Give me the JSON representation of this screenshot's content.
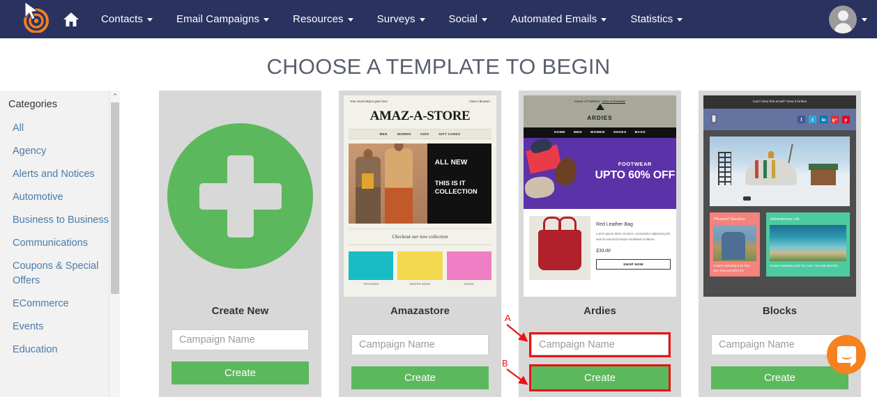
{
  "navbar": {
    "logo_icon": "bullseye-cursor-logo",
    "home_icon": "home-icon",
    "items": [
      {
        "label": "Contacts",
        "caret": true
      },
      {
        "label": "Email Campaigns",
        "caret": true
      },
      {
        "label": "Resources",
        "caret": true
      },
      {
        "label": "Surveys",
        "caret": true
      },
      {
        "label": "Social",
        "caret": true
      },
      {
        "label": "Automated Emails",
        "caret": true
      },
      {
        "label": "Statistics",
        "caret": true
      }
    ],
    "account_icon": "user-avatar-icon",
    "bg_color": "#2a3260"
  },
  "page": {
    "title": "CHOOSE A TEMPLATE TO BEGIN"
  },
  "sidebar": {
    "heading": "Categories",
    "items": [
      {
        "label": "All"
      },
      {
        "label": "Agency"
      },
      {
        "label": "Alerts and Notices"
      },
      {
        "label": "Automotive"
      },
      {
        "label": "Business to Business"
      },
      {
        "label": "Communications"
      },
      {
        "label": "Coupons & Special Offers"
      },
      {
        "label": "ECommerce"
      },
      {
        "label": "Events"
      },
      {
        "label": "Education"
      }
    ],
    "scroll_up_glyph": "⌃",
    "link_color": "#4a7ba8"
  },
  "cards": [
    {
      "name": "Create New",
      "type": "new",
      "input_placeholder": "Campaign Name",
      "button_label": "Create",
      "highlighted": false
    },
    {
      "name": "Amazastore",
      "type": "template",
      "input_placeholder": "Campaign Name",
      "button_label": "Create",
      "highlighted": false,
      "preview": {
        "subject_line": "Your email subject goes here",
        "view_in_browser": "View in Browser",
        "brand": "AMAZ-A-STORE",
        "nav": [
          "MEN",
          "WOMEN",
          "KIDS",
          "GIFT CARDS"
        ],
        "hero_line1": "ALL NEW",
        "hero_line2": "THIS IS IT COLLECTION",
        "tagline": "Checkout our new collection",
        "products": [
          {
            "caption": "TROUSERS",
            "color": "#19bcc4"
          },
          {
            "caption": "WINTER WEAR",
            "color": "#f2d94e"
          },
          {
            "caption": "SHOES",
            "color": "#ef7ec5"
          }
        ]
      }
    },
    {
      "name": "Ardies",
      "type": "template",
      "input_placeholder": "Campaign Name",
      "button_label": "Create",
      "highlighted": true,
      "preview": {
        "top_line": "Home of Fashion.",
        "view_in_browser": "View in browser",
        "brand": "ARDIES",
        "nav": [
          "HOME",
          "MEN",
          "WOMEN",
          "SHOES",
          "BAGS"
        ],
        "hero_line1": "FOOTWEAR",
        "hero_line2": "UPTO 60% OFF",
        "product_title": "Red Leather Bag",
        "product_desc": "Lorem ipsum dolor sit amet, consectetur adipiscing elit, sed do eiusmod tempor incididunt ut labore.",
        "product_price": "$30.00",
        "product_button": "SHOP NOW"
      }
    },
    {
      "name": "Blocks",
      "type": "template",
      "input_placeholder": "Campaign Name",
      "button_label": "Create",
      "highlighted": false,
      "preview": {
        "top_bar": "Can't View this email? View it Online",
        "social": [
          "f",
          "t",
          "in",
          "g+",
          "p"
        ],
        "col1_title": "Pleasent Vacation",
        "col1_text": "Content marketing is far from over. How and when the",
        "col2_title": "Adventurous Life",
        "col2_text": "Content marketing is far from over. How and when the"
      }
    }
  ],
  "annotations": [
    {
      "label": "A",
      "target": "ardies-campaign-name-input"
    },
    {
      "label": "B",
      "target": "ardies-create-button"
    }
  ],
  "chat_widget": {
    "icon": "chat-bubble-icon",
    "color": "#f58220"
  },
  "colors": {
    "navbar": "#2a3260",
    "green_button": "#5cb85c",
    "card_bg": "#d8d8d8",
    "highlight_red": "#ee1111",
    "link_blue": "#4a7ba8"
  }
}
